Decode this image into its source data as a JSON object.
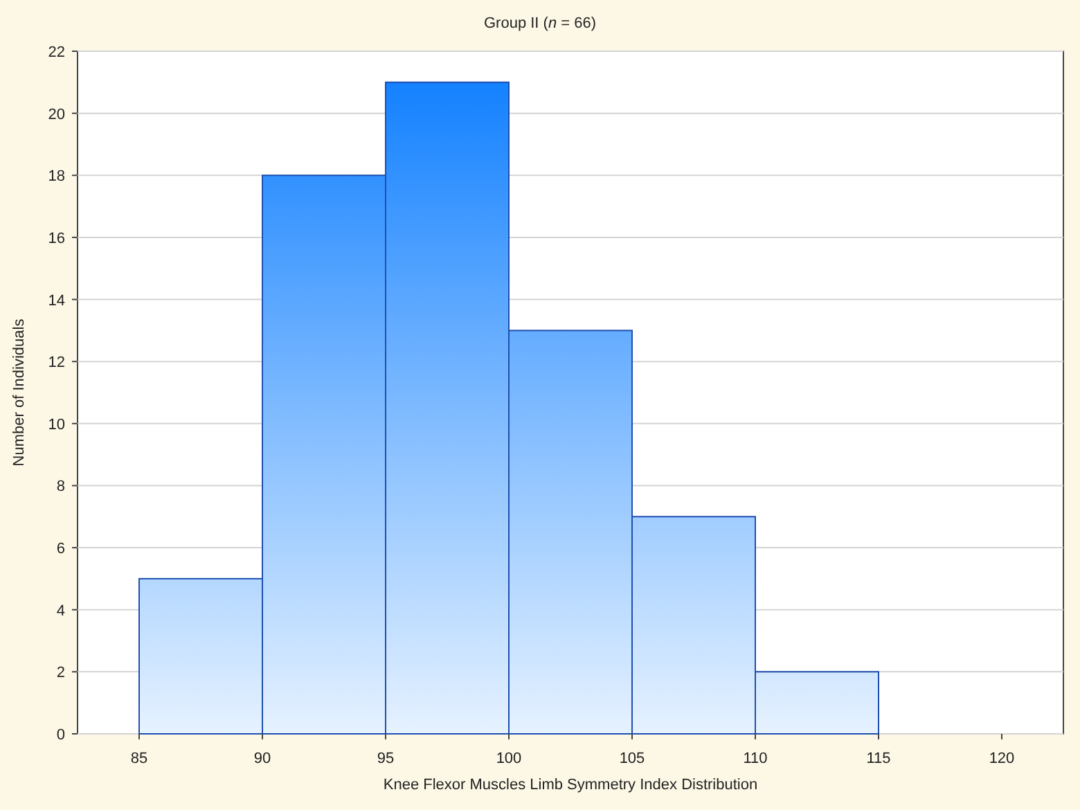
{
  "chart_data": {
    "type": "bar",
    "title": "Group II (*n* = 66)",
    "xlabel": "Knee Flexor Muscles Limb Symmetry Index Distribution",
    "ylabel": "Number of Individuals",
    "x": [
      87.5,
      92.5,
      97.5,
      102.5,
      107.5,
      112.5
    ],
    "values": [
      5,
      18,
      21,
      13,
      7,
      2
    ],
    "xlim": [
      82.5,
      122.5
    ],
    "ylim": [
      0,
      22
    ],
    "xticks": [
      85,
      90,
      95,
      100,
      105,
      110,
      115,
      120
    ],
    "yticks": [
      0,
      2,
      4,
      6,
      8,
      10,
      12,
      14,
      16,
      18,
      20,
      22
    ],
    "grid": true
  }
}
